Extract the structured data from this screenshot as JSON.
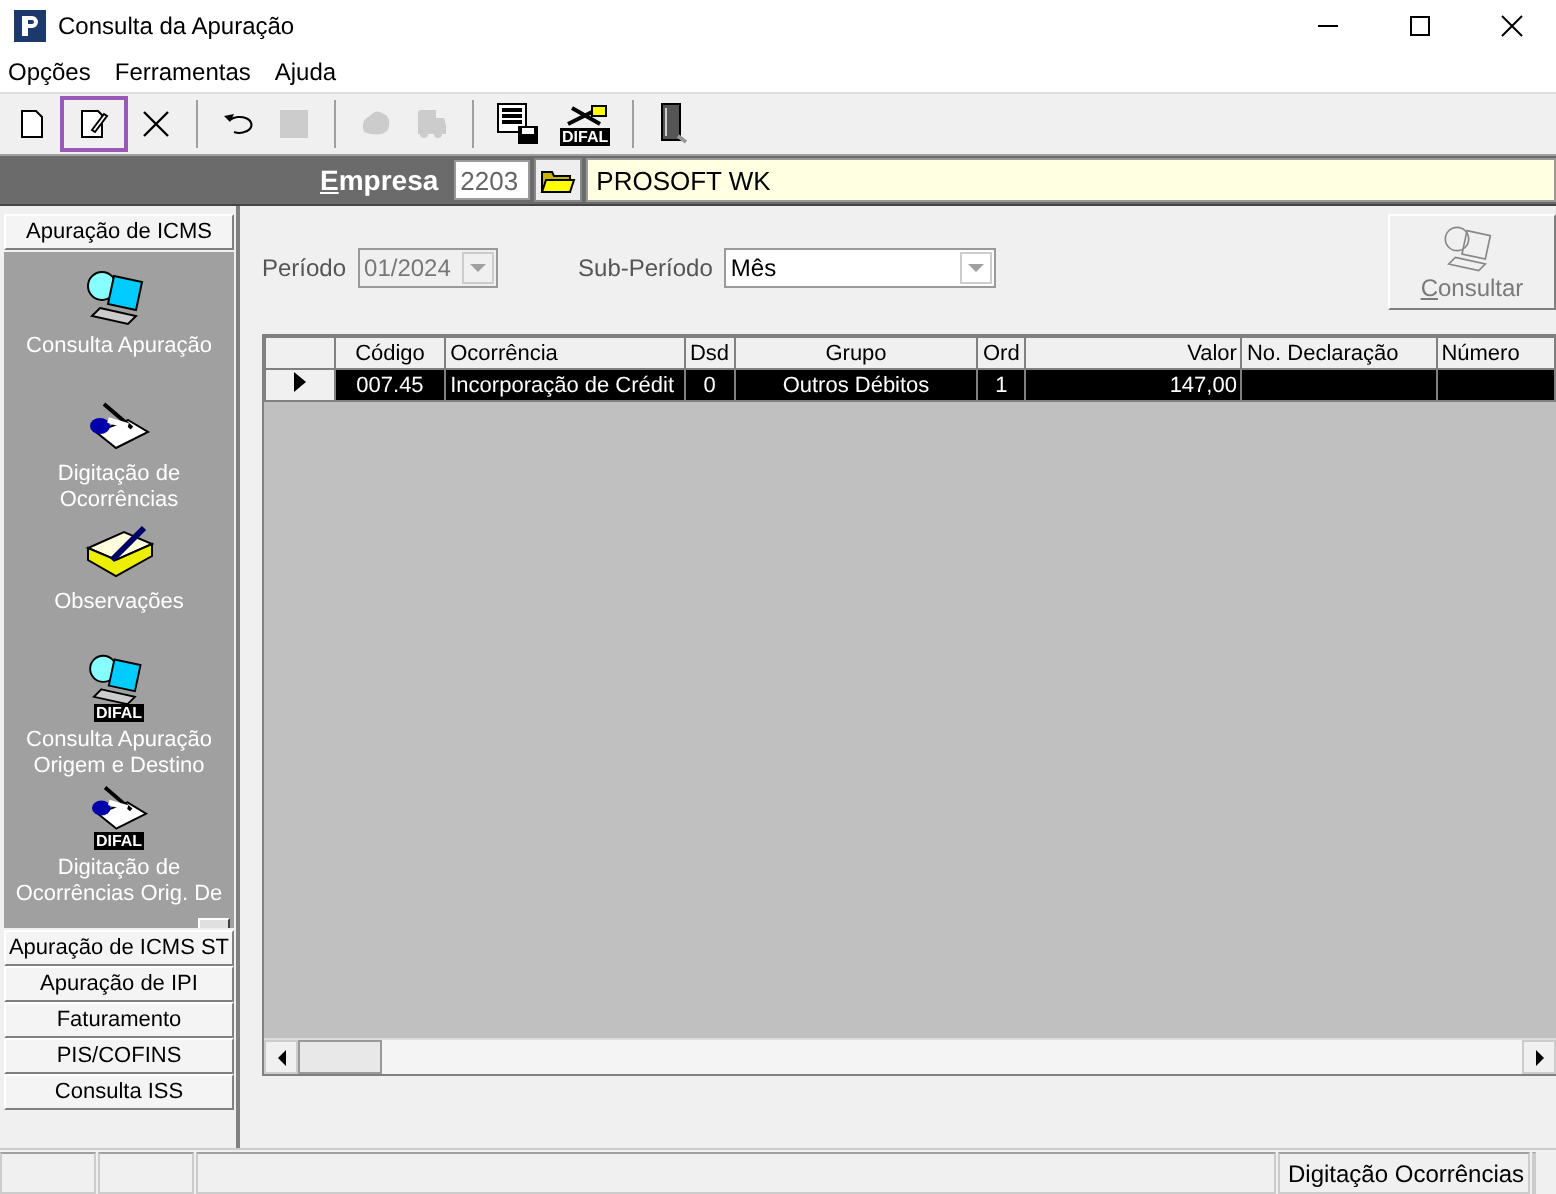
{
  "window": {
    "title": "Consulta da Apuração"
  },
  "menu": [
    "Opções",
    "Ferramentas",
    "Ajuda"
  ],
  "toolbar": [
    {
      "kind": "new",
      "disabled": false,
      "selected": false
    },
    {
      "kind": "edit",
      "disabled": false,
      "selected": true
    },
    {
      "kind": "delete",
      "disabled": false,
      "selected": false
    },
    {
      "kind": "separator"
    },
    {
      "kind": "undo",
      "disabled": false,
      "selected": false
    },
    {
      "kind": "stop",
      "disabled": true,
      "selected": false
    },
    {
      "kind": "separator"
    },
    {
      "kind": "blob",
      "disabled": true,
      "selected": false
    },
    {
      "kind": "truck",
      "disabled": true,
      "selected": false
    },
    {
      "kind": "separator"
    },
    {
      "kind": "report",
      "disabled": false,
      "selected": false
    },
    {
      "kind": "difal",
      "disabled": false,
      "selected": false,
      "badge": "DIFAL"
    },
    {
      "kind": "separator"
    },
    {
      "kind": "exit",
      "disabled": false,
      "selected": false
    }
  ],
  "empresa": {
    "label": "Empresa",
    "code": "2203",
    "name": "PROSOFT WK"
  },
  "sidebar": {
    "groups": [
      {
        "label": "Apuração de ICMS",
        "items": [
          {
            "label": "Consulta Apuração",
            "kind": "laptop"
          },
          {
            "label": "Digitação de Ocorrências",
            "kind": "writing"
          },
          {
            "label": "Observações",
            "kind": "book"
          },
          {
            "label": "Consulta Apuração Origem e Destino",
            "kind": "laptop",
            "badge": "DIFAL"
          },
          {
            "label": "Digitação de Ocorrências Orig. De",
            "kind": "writing",
            "badge": "DIFAL"
          }
        ]
      },
      {
        "label": "Apuração de ICMS ST"
      },
      {
        "label": "Apuração de IPI"
      },
      {
        "label": "Faturamento"
      },
      {
        "label": "PIS/COFINS"
      },
      {
        "label": "Consulta ISS"
      }
    ]
  },
  "filters": [
    {
      "label": "Período",
      "value": "01/2024",
      "disabled": true
    },
    {
      "label": "Sub-Período",
      "value": "Mês",
      "disabled": false
    }
  ],
  "consultar_button": {
    "label": "Consultar",
    "disabled": true
  },
  "table": {
    "columns": [
      "Código",
      "Ocorrência",
      "Dsd",
      "Grupo",
      "Ord",
      "Valor",
      "No. Declaração",
      "Número"
    ],
    "rows": [
      {
        "selected": true,
        "cells": [
          "007.45",
          "Incorporação de Crédit",
          "0",
          "Outros Débitos",
          "1",
          "147,00",
          "",
          ""
        ]
      }
    ]
  },
  "status_bar": {
    "panels": [
      {
        "text": "Digitação Ocorrências"
      }
    ]
  }
}
